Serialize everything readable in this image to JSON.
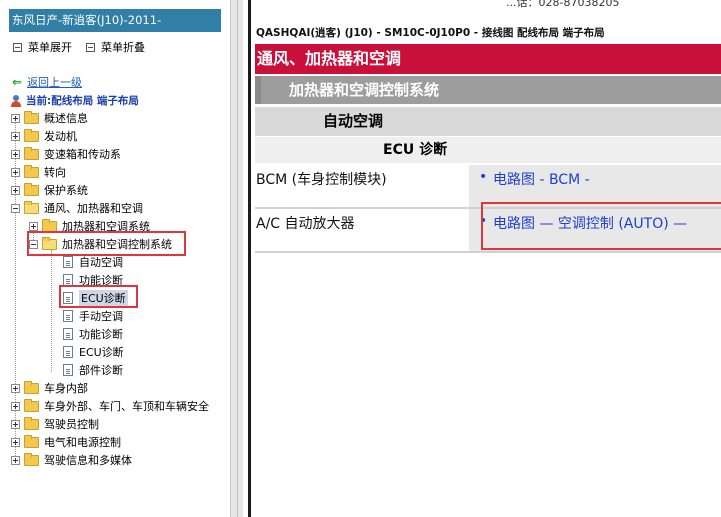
{
  "left": {
    "title": "东风日产-新逍客(J10)-2011-",
    "expand_all": "菜单展开",
    "collapse_all": "菜单折叠",
    "back": "返回上一级",
    "current_label": "当前:",
    "current_path": "配线布局 端子布局",
    "tree": [
      {
        "label": "概述信息",
        "kind": "folder",
        "expander": "plus"
      },
      {
        "label": "发动机",
        "kind": "folder",
        "expander": "plus"
      },
      {
        "label": "变速箱和传动系",
        "kind": "folder",
        "expander": "plus"
      },
      {
        "label": "转向",
        "kind": "folder",
        "expander": "plus"
      },
      {
        "label": "保护系统",
        "kind": "folder",
        "expander": "plus"
      },
      {
        "label": "通风、加热器和空调",
        "kind": "folder",
        "expander": "minus"
      },
      {
        "label": "加热器和空调系统",
        "kind": "folder",
        "expander": "plus"
      },
      {
        "label": "加热器和空调控制系统",
        "kind": "folder",
        "expander": "minus"
      },
      {
        "label": "自动空调",
        "kind": "doc"
      },
      {
        "label": "功能诊断",
        "kind": "doc"
      },
      {
        "label": "ECU诊断",
        "kind": "doc",
        "selected": true
      },
      {
        "label": "手动空调",
        "kind": "doc"
      },
      {
        "label": "功能诊断",
        "kind": "doc"
      },
      {
        "label": "ECU诊断",
        "kind": "doc"
      },
      {
        "label": "部件诊断",
        "kind": "doc"
      },
      {
        "label": "车身内部",
        "kind": "folder",
        "expander": "plus"
      },
      {
        "label": "车身外部、车门、车顶和车辆安全",
        "kind": "folder",
        "expander": "plus"
      },
      {
        "label": "驾驶员控制",
        "kind": "folder",
        "expander": "plus"
      },
      {
        "label": "电气和电源控制",
        "kind": "folder",
        "expander": "plus"
      },
      {
        "label": "驾驶信息和多媒体",
        "kind": "folder",
        "expander": "plus"
      }
    ]
  },
  "right": {
    "top_strip": "...话：028-87038205",
    "header": "QASHQAI(逍客) (J10) - SM10C-0J10P0 - 接线图 配线布局 端子布局",
    "section_main": "通风、加热器和空调",
    "section_sub": "加热器和空调控制系统",
    "section_3": "自动空调",
    "section_4": "ECU 诊断",
    "rows": [
      {
        "name": "BCM (车身控制模块)",
        "link": "电路图 - BCM -"
      },
      {
        "name": "A/C 自动放大器",
        "link": "电路图 — 空调控制 (AUTO) —"
      }
    ]
  },
  "colors": {
    "title_bar": "#2f7fa6",
    "section_main": "#c8103a",
    "link": "#1f3fd0",
    "highlight_box": "#e0353a"
  }
}
